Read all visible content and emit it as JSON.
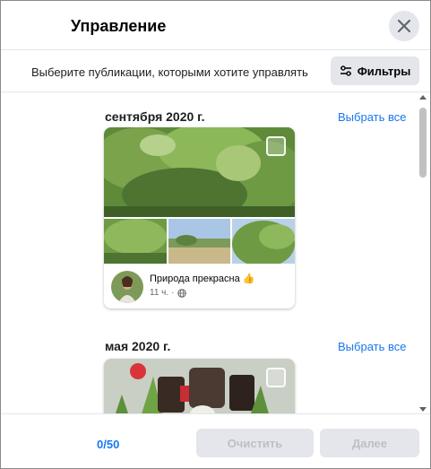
{
  "header": {
    "title": "Управление",
    "close_icon": "close-icon"
  },
  "subbar": {
    "description": "Выберите публикации, которыми хотите управлять",
    "filter_label": "Фильтры",
    "filter_icon": "sliders-icon"
  },
  "sections": [
    {
      "date": "сентября 2020 г.",
      "select_all": "Выбрать все",
      "post": {
        "text": "Природа прекрасна 👍",
        "time": "11 ч.",
        "privacy_icon": "globe-icon"
      }
    },
    {
      "date": "мая 2020 г.",
      "select_all": "Выбрать все"
    }
  ],
  "footer": {
    "counter": "0/50",
    "clear_label": "Очистить",
    "next_label": "Далее"
  },
  "colors": {
    "accent": "#1877f2",
    "button_bg": "#e4e6eb",
    "disabled_text": "#bcc0c4"
  }
}
